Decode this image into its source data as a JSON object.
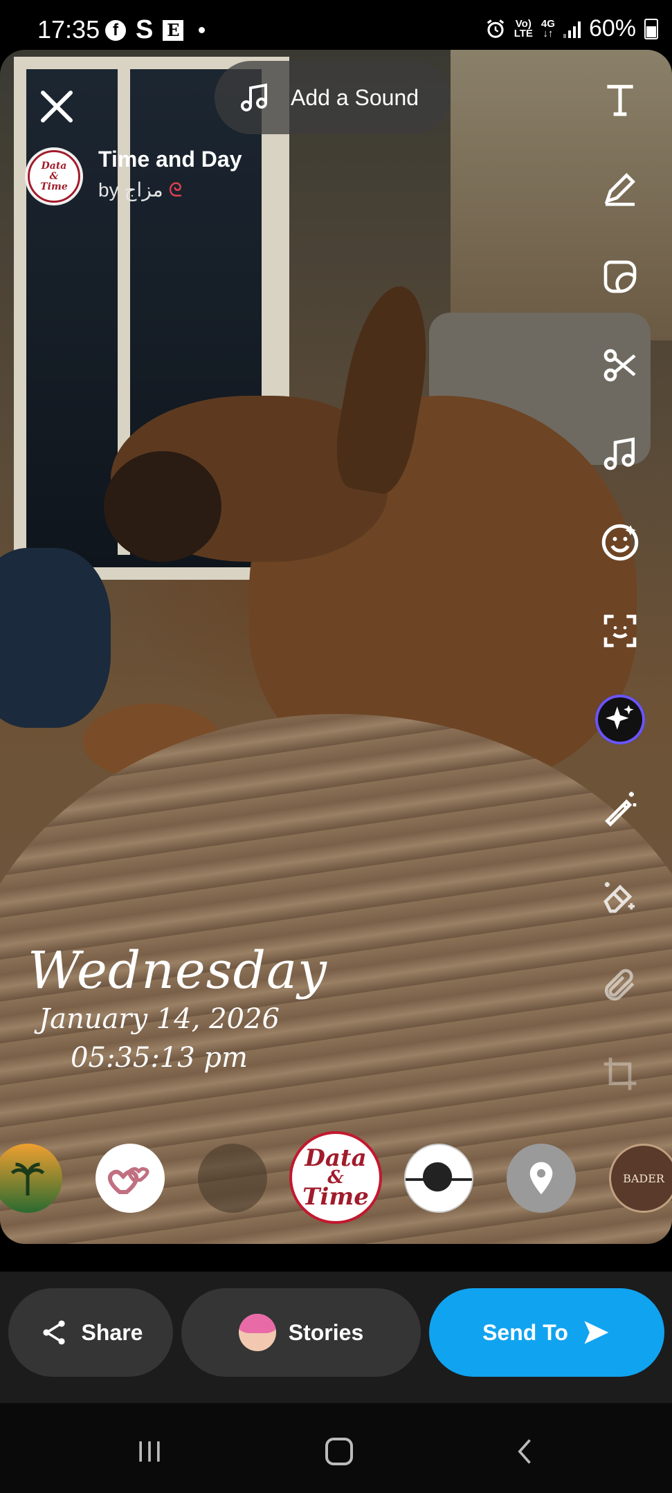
{
  "status_bar": {
    "time": "17:35",
    "left_icons": [
      "facebook-icon",
      "s-app-icon",
      "e-app-icon",
      "dot"
    ],
    "s_letter": "S",
    "e_letter": "E",
    "network_top": "Vo)",
    "network_bottom": "LTE",
    "data_top": "4G",
    "battery": "60%"
  },
  "sound_button": {
    "label": "Add a Sound"
  },
  "lens": {
    "title": "Time and Day",
    "by": "by مزاج",
    "avatar_text": [
      "Data",
      "&",
      "Time"
    ]
  },
  "overlay_text": {
    "day": "Wednesday",
    "date": "January 14, 2026",
    "time": "05:35:13 pm"
  },
  "toolbar_icons": [
    "text-tool-icon",
    "draw-tool-icon",
    "sticker-tool-icon",
    "scissors-tool-icon",
    "music-tool-icon",
    "emoji-lens-icon",
    "scan-tool-icon",
    "ai-sparkle-icon",
    "magic-wand-icon",
    "eraser-tool-icon",
    "attach-link-icon",
    "crop-tool-icon"
  ],
  "carousel": {
    "active_lens_text": [
      "Data",
      "&",
      "Time"
    ],
    "badge_text": "BADER"
  },
  "actions": {
    "share": "Share",
    "stories": "Stories",
    "send": "Send To"
  },
  "colors": {
    "send_blue": "#10a3f0",
    "pill_gray": "#353535",
    "lens_red": "#a01c2c"
  }
}
